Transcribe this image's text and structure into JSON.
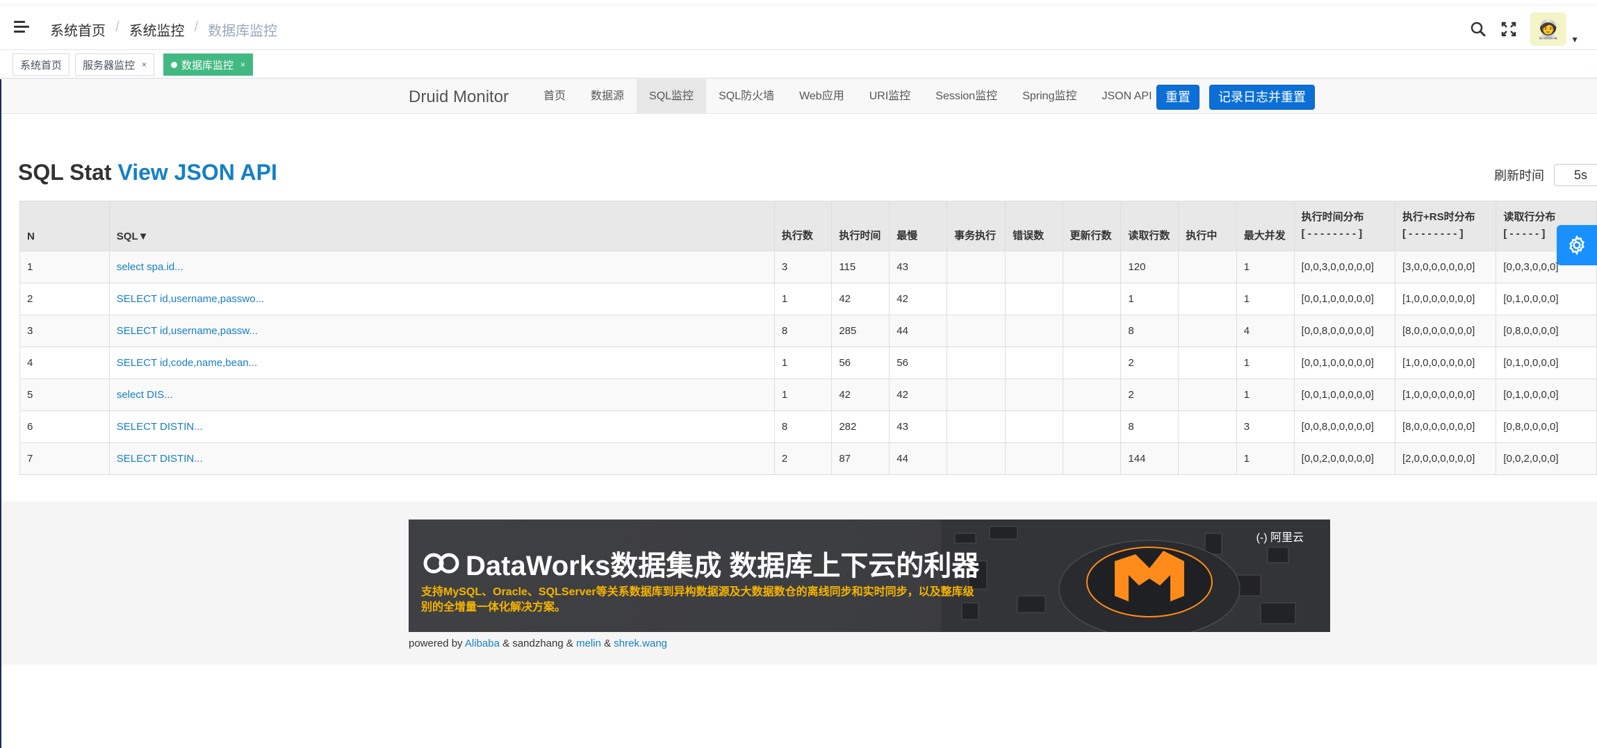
{
  "header": {
    "breadcrumb": [
      "系统首页",
      "系统监控",
      "数据库监控"
    ]
  },
  "tags": [
    {
      "label": "系统首页",
      "closable": false,
      "active": false
    },
    {
      "label": "服务器监控",
      "closable": true,
      "active": false
    },
    {
      "label": "数据库监控",
      "closable": true,
      "active": true
    }
  ],
  "druid": {
    "brand": "Druid Monitor",
    "nav": [
      "首页",
      "数据源",
      "SQL监控",
      "SQL防火墙",
      "Web应用",
      "URI监控",
      "Session监控",
      "Spring监控",
      "JSON API"
    ],
    "active_nav": "SQL监控",
    "reset_label": "重置",
    "log_reset_label": "记录日志并重置"
  },
  "sql_stat": {
    "title": "SQL Stat",
    "json_link": "View JSON API",
    "refresh_label": "刷新时间",
    "refresh_value": "5s",
    "columns": [
      "N",
      "SQL▼",
      "执行数",
      "执行时间",
      "最慢",
      "事务执行",
      "错误数",
      "更新行数",
      "读取行数",
      "执行中",
      "最大并发"
    ],
    "dist_columns": [
      {
        "label": "执行时间分布",
        "sub": "[ - - - - - - - - ]"
      },
      {
        "label": "执行+RS时分布",
        "sub": "[ - - - - - - - - ]"
      },
      {
        "label": "读取行分布",
        "sub": "[ - - - - - ]"
      }
    ],
    "rows": [
      {
        "n": "1",
        "sql": "select spa.id...",
        "exec": "3",
        "time": "115",
        "slowest": "43",
        "tx": "",
        "err": "",
        "upd": "",
        "read": "120",
        "running": "",
        "concurrent": "1",
        "dist1": "[0,0,3,0,0,0,0,0]",
        "dist2": "[3,0,0,0,0,0,0,0]",
        "dist3": "[0,0,3,0,0,0]"
      },
      {
        "n": "2",
        "sql": "SELECT id,username,passwo...",
        "exec": "1",
        "time": "42",
        "slowest": "42",
        "tx": "",
        "err": "",
        "upd": "",
        "read": "1",
        "running": "",
        "concurrent": "1",
        "dist1": "[0,0,1,0,0,0,0,0]",
        "dist2": "[1,0,0,0,0,0,0,0]",
        "dist3": "[0,1,0,0,0,0]"
      },
      {
        "n": "3",
        "sql": "SELECT id,username,passw...",
        "exec": "8",
        "time": "285",
        "slowest": "44",
        "tx": "",
        "err": "",
        "upd": "",
        "read": "8",
        "running": "",
        "concurrent": "4",
        "dist1": "[0,0,8,0,0,0,0,0]",
        "dist2": "[8,0,0,0,0,0,0,0]",
        "dist3": "[0,8,0,0,0,0]"
      },
      {
        "n": "4",
        "sql": "SELECT id,code,name,bean...",
        "exec": "1",
        "time": "56",
        "slowest": "56",
        "tx": "",
        "err": "",
        "upd": "",
        "read": "2",
        "running": "",
        "concurrent": "1",
        "dist1": "[0,0,1,0,0,0,0,0]",
        "dist2": "[1,0,0,0,0,0,0,0]",
        "dist3": "[0,1,0,0,0,0]"
      },
      {
        "n": "5",
        "sql": "select DIS...",
        "exec": "1",
        "time": "42",
        "slowest": "42",
        "tx": "",
        "err": "",
        "upd": "",
        "read": "2",
        "running": "",
        "concurrent": "1",
        "dist1": "[0,0,1,0,0,0,0,0]",
        "dist2": "[1,0,0,0,0,0,0,0]",
        "dist3": "[0,1,0,0,0,0]"
      },
      {
        "n": "6",
        "sql": "SELECT DISTIN...",
        "exec": "8",
        "time": "282",
        "slowest": "43",
        "tx": "",
        "err": "",
        "upd": "",
        "read": "8",
        "running": "",
        "concurrent": "3",
        "dist1": "[0,0,8,0,0,0,0,0]",
        "dist2": "[8,0,0,0,0,0,0,0]",
        "dist3": "[0,8,0,0,0,0]"
      },
      {
        "n": "7",
        "sql": "SELECT DISTIN...",
        "exec": "2",
        "time": "87",
        "slowest": "44",
        "tx": "",
        "err": "",
        "upd": "",
        "read": "144",
        "running": "",
        "concurrent": "1",
        "dist1": "[0,0,2,0,0,0,0,0]",
        "dist2": "[2,0,0,0,0,0,0,0]",
        "dist3": "[0,0,2,0,0,0]"
      }
    ]
  },
  "footer": {
    "banner_title": "DataWorks数据集成 数据库上下云的利器",
    "banner_sub": "支持MySQL、Oracle、SQLServer等关系数据库到异构数据源及大数据数仓的离线同步和实时同步，以及整库级别的全增量一体化解决方案。",
    "banner_logo": "(-) 阿里云",
    "powered_prefix": "powered by",
    "powered_links": [
      "Alibaba",
      "sandzhang",
      "melin",
      "shrek.wang"
    ],
    "powered_sep": "&"
  },
  "colors": {
    "accent": "#1580c4",
    "active_tag": "#42b983",
    "button": "#0b6fd7",
    "gear": "#1890ff",
    "banner_sub": "#f6b400"
  }
}
